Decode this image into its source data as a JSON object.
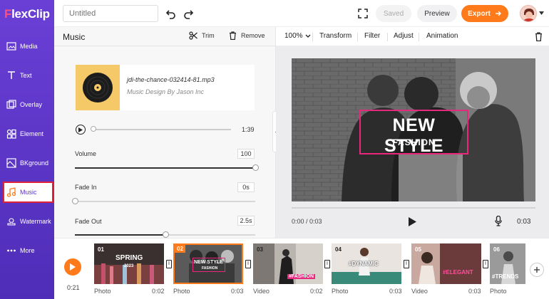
{
  "app": {
    "logo_prefix": "F",
    "logo_rest": "lexClip"
  },
  "sidebar": {
    "items": [
      {
        "label": "Media",
        "icon": "media-icon"
      },
      {
        "label": "Text",
        "icon": "text-icon"
      },
      {
        "label": "Overlay",
        "icon": "overlay-icon"
      },
      {
        "label": "Element",
        "icon": "element-icon"
      },
      {
        "label": "BKground",
        "icon": "background-icon"
      },
      {
        "label": "Music",
        "icon": "music-icon",
        "active": true
      },
      {
        "label": "Watermark",
        "icon": "watermark-icon"
      },
      {
        "label": "More",
        "icon": "more-icon"
      }
    ]
  },
  "topbar": {
    "title_placeholder": "Untitled",
    "saved_label": "Saved",
    "preview_label": "Preview",
    "export_label": "Export"
  },
  "music_panel": {
    "title": "Music",
    "trim_label": "Trim",
    "remove_label": "Remove",
    "track_name": "jdi-the-chance-032414-81.mp3",
    "track_author": "Music Design By Jason Inc",
    "duration": "1:39",
    "volume_label": "Volume",
    "volume_value": "100",
    "fade_in_label": "Fade In",
    "fade_in_value": "0s",
    "fade_out_label": "Fade Out",
    "fade_out_value": "2.5s",
    "volume_level": 1.0,
    "fade_in_level": 0.0,
    "fade_out_level": 0.5
  },
  "editor_toolbar": {
    "zoom": "100%",
    "transform": "Transform",
    "filter": "Filter",
    "adjust": "Adjust",
    "animation": "Animation"
  },
  "stage": {
    "headline": "NEW STYLE",
    "subline": "FASHION",
    "current_time": "0:00 / 0:03",
    "end_time": "0:03"
  },
  "timeline": {
    "total_time": "0:21",
    "clips": [
      {
        "num": "01",
        "type": "Photo",
        "duration": "0:02",
        "text": "SPRING",
        "sub": "2023"
      },
      {
        "num": "02",
        "type": "Photo",
        "duration": "0:03",
        "text": "NEW STYLE",
        "sub": "FASHION"
      },
      {
        "num": "03",
        "type": "Video",
        "duration": "0:02",
        "text": "#FASHION",
        "sub": ""
      },
      {
        "num": "04",
        "type": "Photo",
        "duration": "0:03",
        "text": "#DYNAMIC",
        "sub": ""
      },
      {
        "num": "05",
        "type": "Video",
        "duration": "0:03",
        "text": "#ELEGANT",
        "sub": ""
      },
      {
        "num": "06",
        "type": "Photo",
        "duration": "",
        "text": "#TRENDS",
        "sub": ""
      }
    ]
  },
  "colors": {
    "brand_purple": "#5b34c8",
    "accent_orange": "#ff7a1a",
    "highlight_pink": "#e8287d",
    "active_outline": "#e0233b"
  }
}
